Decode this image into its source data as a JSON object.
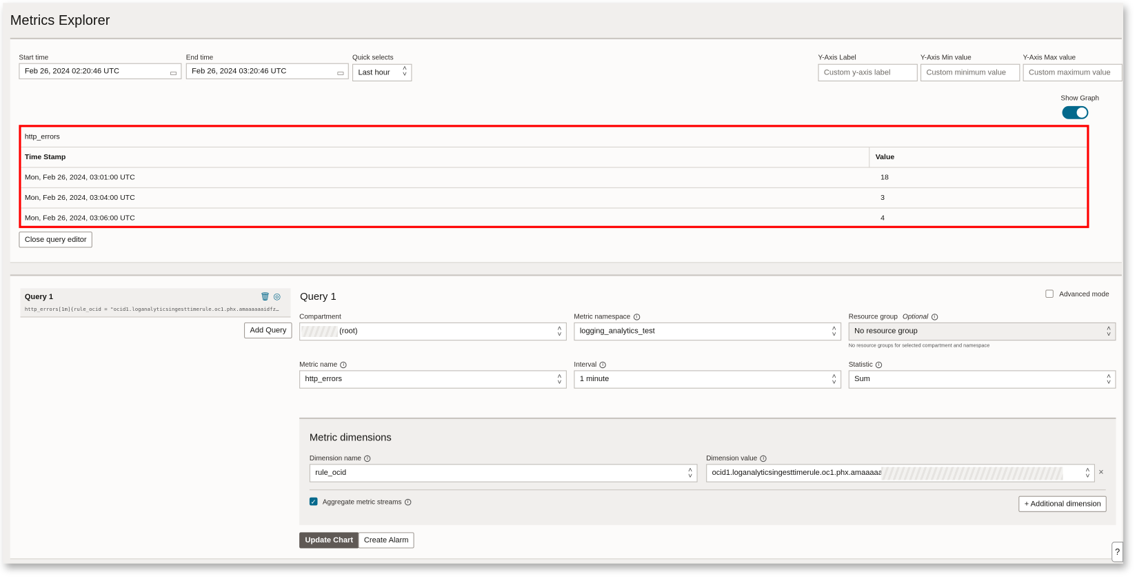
{
  "header": {
    "title": "Metrics Explorer"
  },
  "time": {
    "start_label": "Start time",
    "start_value": "Feb 26, 2024 02:20:46 UTC",
    "end_label": "End time",
    "end_value": "Feb 26, 2024 03:20:46 UTC",
    "quick_label": "Quick selects",
    "quick_value": "Last hour"
  },
  "yaxis": {
    "label_label": "Y-Axis Label",
    "label_placeholder": "Custom y-axis label",
    "min_label": "Y-Axis Min value",
    "min_placeholder": "Custom minimum value",
    "max_label": "Y-Axis Max value",
    "max_placeholder": "Custom maximum value"
  },
  "show_graph": {
    "label": "Show Graph",
    "on": true
  },
  "table": {
    "title": "http_errors",
    "columns": [
      "Time Stamp",
      "Value"
    ],
    "rows": [
      {
        "ts": "Mon, Feb 26, 2024, 03:01:00 UTC",
        "value": "18"
      },
      {
        "ts": "Mon, Feb 26, 2024, 03:04:00 UTC",
        "value": "3"
      },
      {
        "ts": "Mon, Feb 26, 2024, 03:06:00 UTC",
        "value": "4"
      }
    ]
  },
  "close_editor": "Close query editor",
  "query_list": {
    "name": "Query 1",
    "expression": "http_errors[1m]{rule_ocid = \"ocid1.loganalyticsingesttimerule.oc1.phx.amaaaaaaidfz…",
    "add_query": "Add Query"
  },
  "editor": {
    "title": "Query 1",
    "advanced_mode": "Advanced mode",
    "compartment_label": "Compartment",
    "compartment_value": "(root)",
    "namespace_label": "Metric namespace",
    "namespace_value": "logging_analytics_test",
    "resource_group_label": "Resource group",
    "resource_group_optional": "Optional",
    "resource_group_value": "No resource group",
    "resource_group_help": "No resource groups for selected compartment and namespace",
    "metric_label": "Metric name",
    "metric_value": "http_errors",
    "interval_label": "Interval",
    "interval_value": "1 minute",
    "statistic_label": "Statistic",
    "statistic_value": "Sum"
  },
  "dimensions": {
    "title": "Metric dimensions",
    "name_label": "Dimension name",
    "name_value": "rule_ocid",
    "value_label": "Dimension value",
    "value_value": "ocid1.loganalyticsingesttimerule.oc1.phx.amaaaaaai",
    "aggregate_label": "Aggregate metric streams",
    "aggregate_checked": true,
    "additional": "Additional dimension",
    "remove": "×"
  },
  "actions": {
    "update": "Update Chart",
    "alarm": "Create Alarm"
  },
  "colors": {
    "accent": "#04698c",
    "highlight": "#ff0000",
    "primary_button": "#5f5955"
  }
}
